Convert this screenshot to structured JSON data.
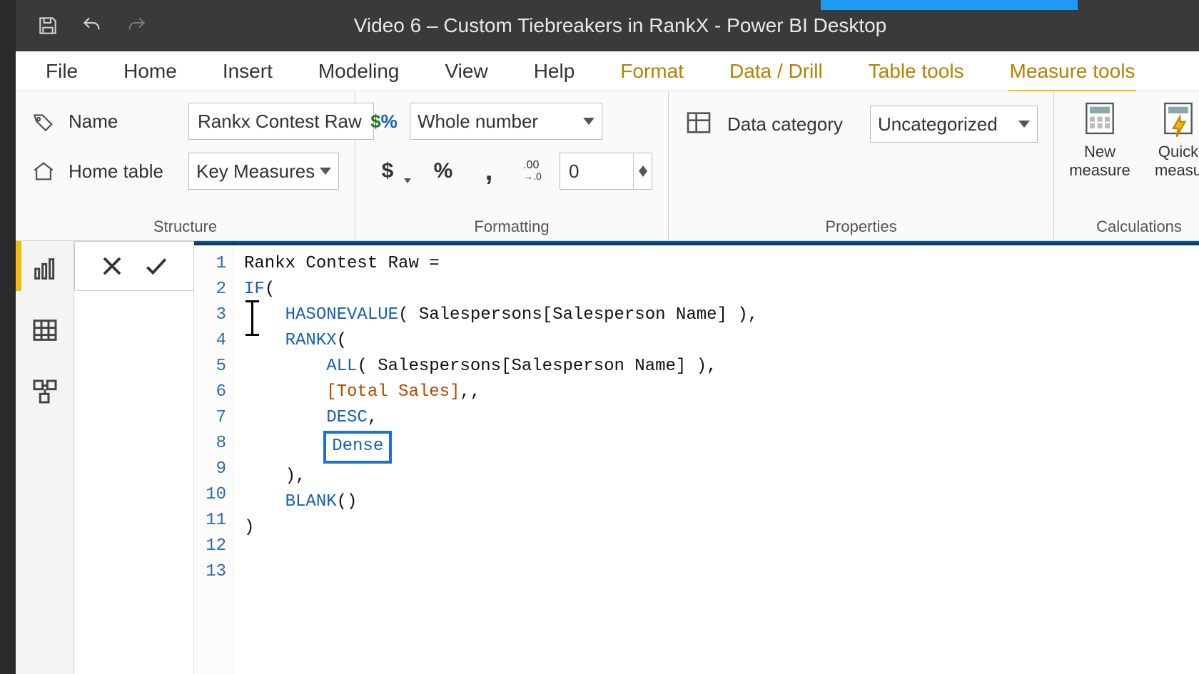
{
  "titlebar": {
    "title": "Video 6 – Custom Tiebreakers in RankX - Power BI Desktop"
  },
  "ribbon_tabs": {
    "file": "File",
    "home": "Home",
    "insert": "Insert",
    "modeling": "Modeling",
    "view": "View",
    "help": "Help",
    "format": "Format",
    "data_drill": "Data / Drill",
    "table_tools": "Table tools",
    "measure_tools": "Measure tools"
  },
  "structure": {
    "name_label": "Name",
    "name_value": "Rankx Contest Raw",
    "home_table_label": "Home table",
    "home_table_value": "Key Measures",
    "group_label": "Structure"
  },
  "formatting": {
    "type_icon": "$%",
    "type_value": "Whole number",
    "currency": "$",
    "percent": "%",
    "comma": ",",
    "precision_icon": ".00→.0",
    "decimals": "0",
    "group_label": "Formatting"
  },
  "properties": {
    "category_label": "Data category",
    "category_value": "Uncategorized",
    "group_label": "Properties"
  },
  "calculations": {
    "new_measure": "New measure",
    "quick_measure": "Quick measu",
    "group_label": "Calculations"
  },
  "code": {
    "l1": "Rankx Contest Raw =",
    "l2": "",
    "l3_if": "IF",
    "l3_rest": "(",
    "l4_fn": "HASONEVALUE",
    "l4_rest": "( Salespersons[Salesperson Name] ),",
    "l5_fn": "RANKX",
    "l5_rest": "(",
    "l6_fn": "ALL",
    "l6_rest": "( Salespersons[Salesperson Name] ),",
    "l7_meas": "[Total Sales]",
    "l7_rest": ",,",
    "l8_ord": "DESC",
    "l8_rest": ",",
    "l9_dense": "Dense",
    "l10": "),",
    "l11_fn": "BLANK",
    "l11_rest": "()",
    "l12": ")",
    "l13": ""
  },
  "line_numbers": [
    "1",
    "2",
    "3",
    "4",
    "5",
    "6",
    "7",
    "8",
    "9",
    "10",
    "11",
    "12",
    "13"
  ]
}
